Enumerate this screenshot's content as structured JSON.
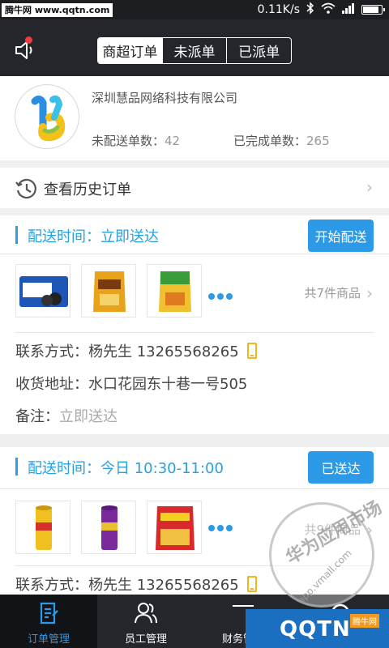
{
  "watermark": {
    "site": "腾牛网 www.qqtn.com"
  },
  "status_bar": {
    "speed": "0.11K/s"
  },
  "header": {
    "tabs": [
      {
        "label": "商超订单",
        "active": true
      },
      {
        "label": "未派单",
        "active": false
      },
      {
        "label": "已派单",
        "active": false
      }
    ]
  },
  "company": {
    "name": "深圳慧品网络科技有限公司",
    "undelivered_label": "未配送单数：",
    "undelivered_value": "42",
    "completed_label": "已完成单数：",
    "completed_value": "265"
  },
  "history": {
    "label": "查看历史订单"
  },
  "orders": [
    {
      "delivery_time": "配送时间：立即送达",
      "button": "开始配送",
      "count": "共7件商品",
      "contact": "联系方式：杨先生  13265568265",
      "address": "收货地址：水口花园东十巷一号505",
      "note_label": "备注：",
      "note_value": "立即送达"
    },
    {
      "delivery_time": "配送时间：今日 10:30-11:00",
      "button": "已送达",
      "count": "共9件商品",
      "contact": "联系方式：杨先生  13265568265"
    }
  ],
  "bottom_nav": [
    {
      "label": "订单管理",
      "active": true
    },
    {
      "label": "员工管理",
      "active": false
    },
    {
      "label": "财务管理",
      "active": false
    },
    {
      "label": "",
      "active": false
    }
  ],
  "overlay": {
    "seal": "华为应用市场",
    "seal_url": "app.vmall.com",
    "brand": "QQTN",
    "brand_small": "腾牛网"
  },
  "colors": {
    "accent": "#2c9ae6",
    "header": "#24262b",
    "phone": "#f2b51a"
  }
}
